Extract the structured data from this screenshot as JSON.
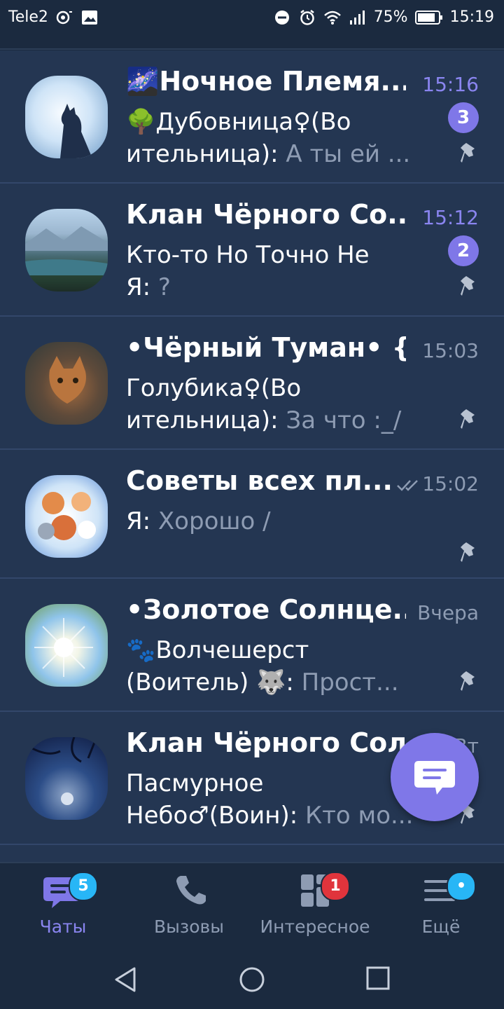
{
  "statusbar": {
    "carrier": "Tele2",
    "battery": "75%",
    "time": "15:19"
  },
  "chats": [
    {
      "title": "🌌Ночное Племя...",
      "time": "15:16",
      "unread": "3",
      "sender_line": "🌳Дубовница♀(Во",
      "sender_cont": "ительница): ",
      "message": "А ты ей ...",
      "avatar": "moon-cat-avatar"
    },
    {
      "title": "Клан Чёрного Со...",
      "time": "15:12",
      "unread": "2",
      "sender_line": "Кто-то Но Точно Не",
      "sender_cont": "Я: ",
      "message": "?",
      "avatar": "mountain-lake-avatar"
    },
    {
      "title": "•Чёрный Туман• {...",
      "time": "15:03",
      "sender_line": "Голубика♀(Во",
      "sender_cont": "ительница): ",
      "message": "За что :_/",
      "avatar": "cat-avatar"
    },
    {
      "title": "Советы всех пл...",
      "time": "15:02",
      "sender_line": "Я: ",
      "message": "Хорошо /",
      "avatar": "cartoon-cats-avatar"
    },
    {
      "title": "•Золотое Солнце...",
      "time": "Вчера",
      "sender_line": "🐾Волчешерст",
      "sender_cont": "(Воитель) 🐺: ",
      "message": "Прост...",
      "avatar": "sunny-tree-avatar"
    },
    {
      "title": "Клан Чёрного Солн",
      "time": "Вт",
      "sender_line": "Пасмурное",
      "sender_cont": "Небо♂(Воин): ",
      "message": "Кто мо...",
      "avatar": "night-moon-avatar"
    }
  ],
  "bottom_nav": [
    {
      "label": "Чаты",
      "badge": "5",
      "icon": "chat-bubble-icon"
    },
    {
      "label": "Вызовы",
      "icon": "phone-icon"
    },
    {
      "label": "Интересное",
      "badge": "1",
      "icon": "explore-grid-icon"
    },
    {
      "label": "Ещё",
      "badge": "•",
      "icon": "menu-icon"
    }
  ],
  "colors": {
    "accent": "#7f77e8",
    "badge_red": "#e0343c",
    "badge_blue": "#28b6f6",
    "bg": "#243652",
    "nav_bg": "#1b2a3f"
  }
}
